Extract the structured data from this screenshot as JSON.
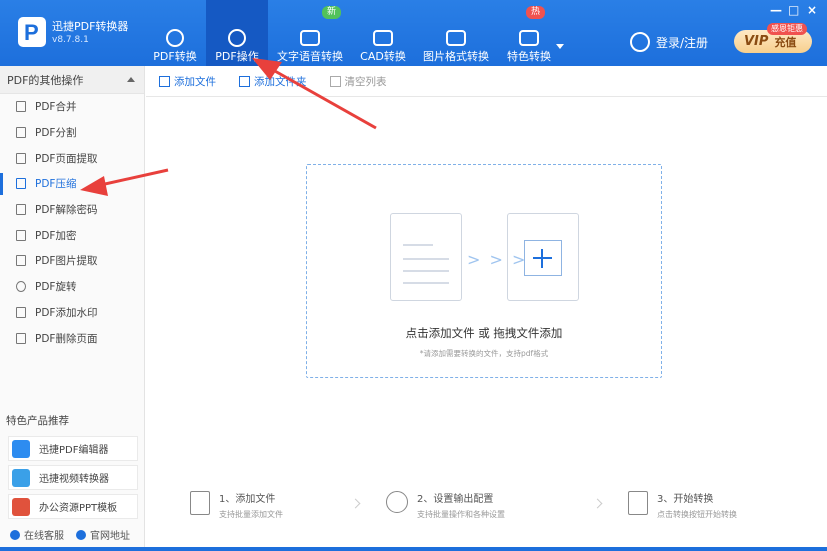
{
  "app": {
    "name": "迅捷PDF转换器",
    "version": "v8.7.8.1"
  },
  "top_nav": [
    {
      "label": "PDF转换",
      "icon": "convert-icon",
      "active": false
    },
    {
      "label": "PDF操作",
      "icon": "disc-icon",
      "active": true
    },
    {
      "label": "文字语音转换",
      "icon": "waveform-icon",
      "active": false,
      "badge": "新",
      "badge_color": "#52c25a"
    },
    {
      "label": "CAD转换",
      "icon": "download-icon",
      "active": false
    },
    {
      "label": "图片格式转换",
      "icon": "image-icon",
      "active": false
    },
    {
      "label": "特色转换",
      "icon": "star-icon",
      "active": false,
      "badge": "热",
      "badge_color": "#f0524f"
    }
  ],
  "header_right": {
    "login_label": "登录/注册",
    "vip_word": "VIP",
    "vip_label": "充值",
    "vip_tag": "感恩钜惠"
  },
  "window_controls": [
    "—",
    "□",
    "×"
  ],
  "sidebar": {
    "section_title": "PDF的其他操作",
    "items": [
      {
        "label": "PDF合并",
        "icon": "merge-icon"
      },
      {
        "label": "PDF分割",
        "icon": "split-icon"
      },
      {
        "label": "PDF页面提取",
        "icon": "page-extract-icon"
      },
      {
        "label": "PDF压缩",
        "icon": "compress-icon",
        "active": true
      },
      {
        "label": "PDF解除密码",
        "icon": "unlock-icon"
      },
      {
        "label": "PDF加密",
        "icon": "shield-icon"
      },
      {
        "label": "PDF图片提取",
        "icon": "image-extract-icon"
      },
      {
        "label": "PDF旋转",
        "icon": "rotate-icon"
      },
      {
        "label": "PDF添加水印",
        "icon": "watermark-icon"
      },
      {
        "label": "PDF删除页面",
        "icon": "delete-page-icon"
      }
    ],
    "recommend_title": "特色产品推荐",
    "recommend": [
      {
        "label": "迅捷PDF编辑器",
        "color": "#2d8cf0"
      },
      {
        "label": "迅捷视频转换器",
        "color": "#3aa0e8"
      },
      {
        "label": "办公资源PPT模板",
        "color": "#e0523c"
      }
    ],
    "footer": [
      {
        "label": "在线客服",
        "icon": "service-icon"
      },
      {
        "label": "官网地址",
        "icon": "globe-icon"
      }
    ]
  },
  "toolbar": {
    "add_file": "添加文件",
    "add_folder": "添加文件夹",
    "clear_list": "清空列表"
  },
  "dropzone": {
    "main_text": "点击添加文件 或 拖拽文件添加",
    "sub_text": "*请添加需要转换的文件，支持pdf格式",
    "arrows": "> > >"
  },
  "steps": [
    {
      "title": "1、添加文件",
      "desc": "支持批量添加文件",
      "icon": "file-add-icon"
    },
    {
      "title": "2、设置输出配置",
      "desc": "支持批量操作和各种设置",
      "icon": "gear-icon"
    },
    {
      "title": "3、开始转换",
      "desc": "点击转换按钮开始转换",
      "icon": "start-convert-icon"
    }
  ],
  "colors": {
    "brand": "#1d6fdc",
    "annotation": "#e8403c"
  }
}
